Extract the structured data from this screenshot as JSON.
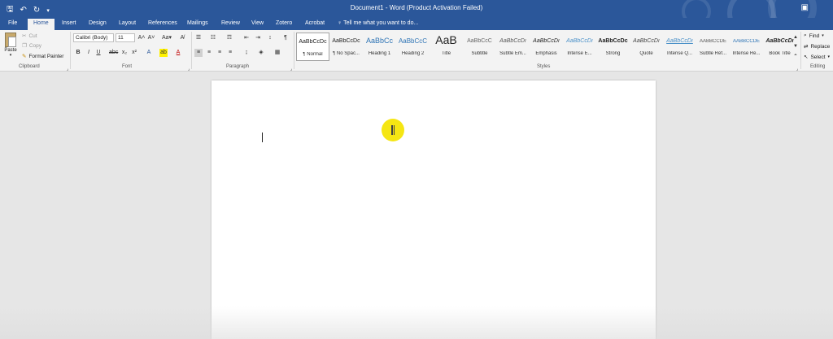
{
  "window": {
    "title": "Document1 - Word (Product Activation Failed)"
  },
  "quick_access": {
    "save_icon": "save-icon",
    "undo_icon": "undo-icon",
    "redo_icon": "redo-icon",
    "customize_icon": "customize-qat-icon"
  },
  "tabs": [
    "File",
    "Home",
    "Insert",
    "Design",
    "Layout",
    "References",
    "Mailings",
    "Review",
    "View",
    "Zotero",
    "Acrobat"
  ],
  "active_tab": "Home",
  "tell_me": "Tell me what you want to do...",
  "clipboard": {
    "paste": "Paste",
    "cut": "Cut",
    "copy": "Copy",
    "format_painter": "Format Painter",
    "group": "Clipboard"
  },
  "font": {
    "family": "Calibri (Body)",
    "size": "11",
    "group": "Font"
  },
  "paragraph": {
    "group": "Paragraph"
  },
  "styles": {
    "group": "Styles",
    "items": [
      {
        "sample": "AaBbCcDc",
        "name": "¶ Normal"
      },
      {
        "sample": "AaBbCcDc",
        "name": "¶ No Spac..."
      },
      {
        "sample": "AaBbCc",
        "name": "Heading 1"
      },
      {
        "sample": "AaBbCcC",
        "name": "Heading 2"
      },
      {
        "sample": "AaB",
        "name": "Title"
      },
      {
        "sample": "AaBbCcC",
        "name": "Subtitle"
      },
      {
        "sample": "AaBbCcDı",
        "name": "Subtle Em..."
      },
      {
        "sample": "AaBbCcDı",
        "name": "Emphasis"
      },
      {
        "sample": "AaBbCcDı",
        "name": "Intense E..."
      },
      {
        "sample": "AaBbCcDc",
        "name": "Strong"
      },
      {
        "sample": "AaBbCcDı",
        "name": "Quote"
      },
      {
        "sample": "AaBbCcDı",
        "name": "Intense Q..."
      },
      {
        "sample": "AABBCCDE",
        "name": "Subtle Ref..."
      },
      {
        "sample": "AABBCCDE",
        "name": "Intense Re..."
      },
      {
        "sample": "AaBbCcDı",
        "name": "Book Title"
      }
    ]
  },
  "editing": {
    "find": "Find",
    "replace": "Replace",
    "select": "Select",
    "group": "Editing"
  },
  "colors": {
    "accent": "#2b579a",
    "ribbon": "#f3f3f3",
    "workspace": "#e6e6e6",
    "pointer": "#f5e400"
  }
}
